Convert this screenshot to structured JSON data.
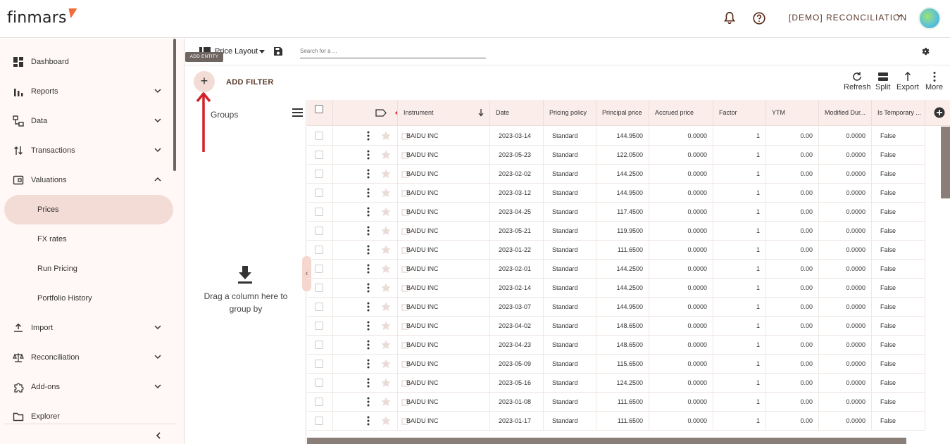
{
  "app": {
    "logo": "finmars"
  },
  "header": {
    "workspace": "[DEMO] RECONCILIATION"
  },
  "sidebar": {
    "items": [
      {
        "label": "Dashboard",
        "icon": "dashboard-icon"
      },
      {
        "label": "Reports",
        "icon": "reports-icon"
      },
      {
        "label": "Data",
        "icon": "data-icon"
      },
      {
        "label": "Transactions",
        "icon": "transactions-icon"
      },
      {
        "label": "Valuations",
        "icon": "valuations-icon"
      },
      {
        "label": "Import",
        "icon": "import-icon"
      },
      {
        "label": "Reconciliation",
        "icon": "reconciliation-icon"
      },
      {
        "label": "Add-ons",
        "icon": "addons-icon"
      },
      {
        "label": "Explorer",
        "icon": "explorer-icon"
      }
    ],
    "valuations_sub": [
      "Prices",
      "FX rates",
      "Run Pricing",
      "Portfolio History"
    ],
    "active_sub": "Prices"
  },
  "toolbar": {
    "layout_name": "Price Layout",
    "search_placeholder": "Search for a ...",
    "tooltip": "ADD ENTITY",
    "add_filter": "ADD FILTER",
    "refresh": "Refresh",
    "split": "Split",
    "export": "Export",
    "more": "More"
  },
  "groups": {
    "title": "Groups",
    "drag_hint": "Drag a column here to group by"
  },
  "table": {
    "columns": [
      "Instrument",
      "Date",
      "Pricing policy",
      "Principal price",
      "Accrued price",
      "Factor",
      "YTM",
      "Modified Dur...",
      "Is Temporary ..."
    ],
    "rows": [
      [
        "BAIDU INC",
        "2023-03-14",
        "Standard",
        "144.9500",
        "0.0000",
        "1",
        "0.00",
        "0.0000",
        "False"
      ],
      [
        "BAIDU INC",
        "2023-05-23",
        "Standard",
        "122.0500",
        "0.0000",
        "1",
        "0.00",
        "0.0000",
        "False"
      ],
      [
        "BAIDU INC",
        "2023-02-02",
        "Standard",
        "144.2500",
        "0.0000",
        "1",
        "0.00",
        "0.0000",
        "False"
      ],
      [
        "BAIDU INC",
        "2023-03-12",
        "Standard",
        "144.9500",
        "0.0000",
        "1",
        "0.00",
        "0.0000",
        "False"
      ],
      [
        "BAIDU INC",
        "2023-04-25",
        "Standard",
        "117.4500",
        "0.0000",
        "1",
        "0.00",
        "0.0000",
        "False"
      ],
      [
        "BAIDU INC",
        "2023-05-21",
        "Standard",
        "119.9500",
        "0.0000",
        "1",
        "0.00",
        "0.0000",
        "False"
      ],
      [
        "BAIDU INC",
        "2023-01-22",
        "Standard",
        "111.6500",
        "0.0000",
        "1",
        "0.00",
        "0.0000",
        "False"
      ],
      [
        "BAIDU INC",
        "2023-02-01",
        "Standard",
        "144.2500",
        "0.0000",
        "1",
        "0.00",
        "0.0000",
        "False"
      ],
      [
        "BAIDU INC",
        "2023-02-14",
        "Standard",
        "144.2500",
        "0.0000",
        "1",
        "0.00",
        "0.0000",
        "False"
      ],
      [
        "BAIDU INC",
        "2023-03-07",
        "Standard",
        "144.9500",
        "0.0000",
        "1",
        "0.00",
        "0.0000",
        "False"
      ],
      [
        "BAIDU INC",
        "2023-04-02",
        "Standard",
        "148.6500",
        "0.0000",
        "1",
        "0.00",
        "0.0000",
        "False"
      ],
      [
        "BAIDU INC",
        "2023-04-23",
        "Standard",
        "148.6500",
        "0.0000",
        "1",
        "0.00",
        "0.0000",
        "False"
      ],
      [
        "BAIDU INC",
        "2023-05-09",
        "Standard",
        "115.6500",
        "0.0000",
        "1",
        "0.00",
        "0.0000",
        "False"
      ],
      [
        "BAIDU INC",
        "2023-05-16",
        "Standard",
        "124.2500",
        "0.0000",
        "1",
        "0.00",
        "0.0000",
        "False"
      ],
      [
        "BAIDU INC",
        "2023-01-08",
        "Standard",
        "111.6500",
        "0.0000",
        "1",
        "0.00",
        "0.0000",
        "False"
      ],
      [
        "BAIDU INC",
        "2023-01-17",
        "Standard",
        "111.6500",
        "0.0000",
        "1",
        "0.00",
        "0.0000",
        "False"
      ]
    ]
  },
  "colors": {
    "accent": "#f26a36",
    "active_bg": "#f4dcd6",
    "header_bg": "#fbeeea",
    "annotation": "#d4202a"
  }
}
